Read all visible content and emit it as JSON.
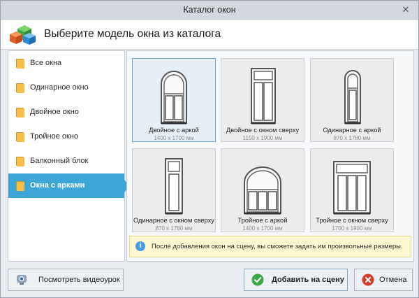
{
  "window": {
    "title": "Каталог окон",
    "close_glyph": "✕"
  },
  "header": {
    "heading": "Выберите модель окна из каталога"
  },
  "sidebar": {
    "items": [
      {
        "label": "Все окна",
        "icon": "folder-icon"
      },
      {
        "label": "Одинарное окно",
        "icon": "folder-icon"
      },
      {
        "label": "Двойное окно",
        "icon": "folder-icon"
      },
      {
        "label": "Тройное окно",
        "icon": "folder-icon"
      },
      {
        "label": "Балконный блок",
        "icon": "folder-icon"
      },
      {
        "label": "Окна с арками",
        "icon": "folder-icon",
        "active": true
      }
    ]
  },
  "catalog": {
    "items": [
      {
        "name": "Двойное с аркой",
        "size": "1400 x 1700 мм",
        "selected": true
      },
      {
        "name": "Двойное с окном сверху",
        "size": "1150 x 1900 мм"
      },
      {
        "name": "Одинарное с аркой",
        "size": "870 x 1780 мм"
      },
      {
        "name": "Одинарное с окном сверху",
        "size": "870 x 1780 мм"
      },
      {
        "name": "Тройное с аркой",
        "size": "1400 x 1700 мм"
      },
      {
        "name": "Тройное с окном сверху",
        "size": "1700 x 1900 мм"
      }
    ]
  },
  "info": {
    "icon": "info-icon",
    "glyph": "i",
    "text": "После добавления окон на сцену, вы сможете задать им произвольные размеры."
  },
  "buttons": {
    "video": {
      "label": "Посмотреть видеоурок",
      "icon": "webcam-icon"
    },
    "add": {
      "label": "Добавить на сцену",
      "icon": "check-icon"
    },
    "cancel": {
      "label": "Отмена",
      "icon": "cancel-icon"
    }
  },
  "colors": {
    "accent": "#3ea6d6",
    "info_bg": "#fdf8d2",
    "check_green": "#3aa845",
    "cancel_red": "#d83a2e"
  }
}
